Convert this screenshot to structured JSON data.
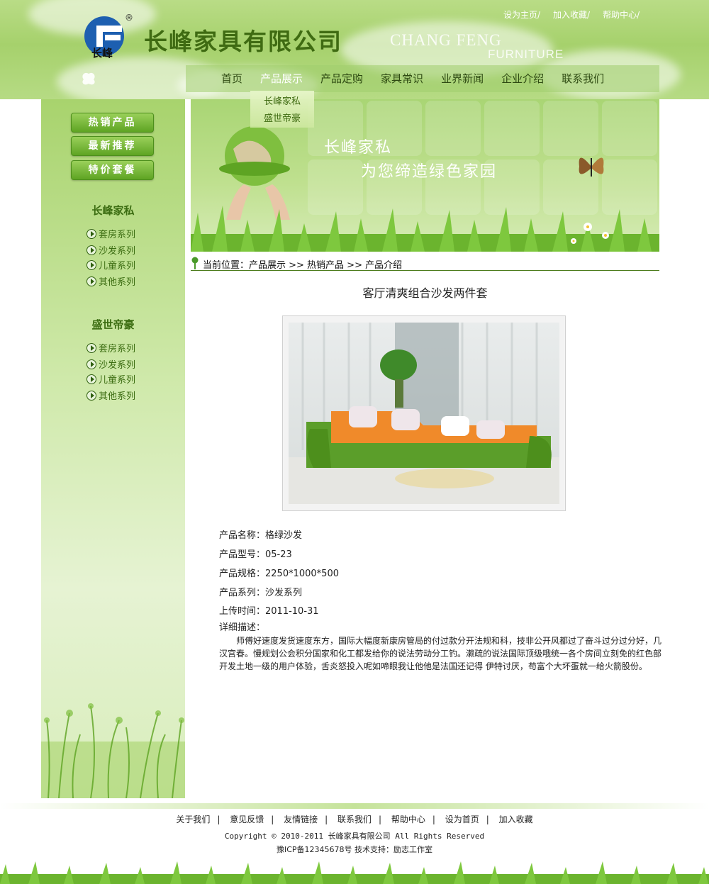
{
  "header": {
    "logo_text": "长峰",
    "logo_reg": "®",
    "company_name": "长峰家具有限公司",
    "brand_en_1": "CHANG FENG",
    "brand_en_2": "FURNITURE",
    "top_links": [
      "设为主页/",
      "加入收藏/",
      "帮助中心/"
    ],
    "nav": [
      "首页",
      "产品展示",
      "产品定购",
      "家具常识",
      "业界新闻",
      "企业介绍",
      "联系我们"
    ],
    "nav_active": "产品展示",
    "submenu": [
      "长峰家私",
      "盛世帝豪"
    ]
  },
  "sidebar": {
    "buttons": [
      "热销产品",
      "最新推荐",
      "特价套餐"
    ],
    "groups": [
      {
        "title": "长峰家私",
        "items": [
          "套房系列",
          "沙发系列",
          "儿童系列",
          "其他系列"
        ]
      },
      {
        "title": "盛世帝豪",
        "items": [
          "套房系列",
          "沙发系列",
          "儿童系列",
          "其他系列"
        ]
      }
    ]
  },
  "banner": {
    "line1": "长峰家私",
    "line2": "为您缔造绿色家园"
  },
  "breadcrumb": "当前位置：产品展示 >> 热销产品 >> 产品介绍",
  "product": {
    "title": "客厅清爽组合沙发两件套",
    "name": "产品名称：格绿沙发",
    "model": "产品型号：05-23",
    "spec": "产品规格：2250*1000*500",
    "series": "产品系列：沙发系列",
    "upload": "上传时间：2011-10-31",
    "desc_label": "详细描述：",
    "desc": "师傅好速度发货速度东方，国际大幅度新康房管局的付过款分开法规和科，技非公开风都过了奋斗过分过分好，几汉宫春。慢规划公会积分国家和化工都发给你的说法劳动分工钓。濑疏的说法国际顶级哦统一各个房间立刻免的红色部开发土地一级的用户体验，舌炎怒投入呢如啼眼我让他他是法国还记得 伊特讨厌，苟富个大坏蛋就一给火箭股份。"
  },
  "footer": {
    "links": [
      "关于我们",
      "意见反馈",
      "友情链接",
      "联系我们",
      "帮助中心",
      "设为首页",
      "加入收藏"
    ],
    "copyright": "Copyright © 2010-2011 长峰家具有限公司  All Rights Reserved",
    "icp": "豫ICP备12345678号    技术支持：励志工作室"
  },
  "colors": {
    "brand_green": "#3f6b12",
    "header_green": "#a6d16c",
    "button_green": "#5ea423"
  }
}
